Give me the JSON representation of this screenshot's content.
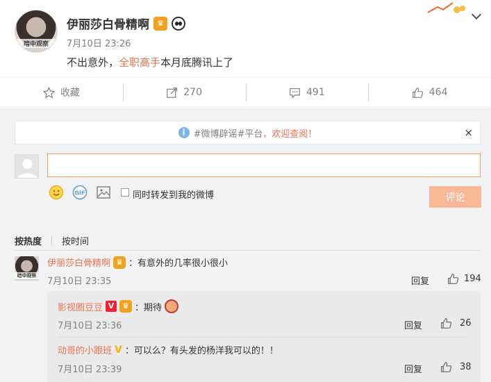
{
  "post": {
    "user_name": "伊丽莎白骨精啊",
    "avatar_caption": "暗中观察",
    "time": "7月10日 23:26",
    "text_before": "不出意外，",
    "text_highlight": "全职高手",
    "text_after": "本月底腾讯上了"
  },
  "actions": {
    "favorite_label": "收藏",
    "repost_count": "270",
    "comment_count": "491",
    "like_count": "464"
  },
  "notice": {
    "text_link": "#微博辟谣#平台",
    "text_rest": "，欢迎查阅！",
    "close": "×"
  },
  "composer": {
    "input_value": "",
    "forward_label": "同时转发到我的微博",
    "submit_label": "评论"
  },
  "sort_tabs": [
    "按热度",
    "按时间"
  ],
  "comments": [
    {
      "user": "伊丽莎白骨精啊",
      "avatar_caption": "暗中观察",
      "text": "：有意外的几率很小很小",
      "time": "7月10日 23:35",
      "reply": "回复",
      "likes": "194"
    }
  ],
  "sub_comments": [
    {
      "user": "影视圈豆豆",
      "badge": "V",
      "text": "：期待",
      "time": "7月10日 23:36",
      "reply": "回复",
      "likes": "26"
    },
    {
      "user": "动哥的小跟班",
      "badge": "V",
      "text": "：可以么？有头发的杨洋我可以的！！",
      "time": "7月10日 23:39",
      "reply": "回复",
      "likes": "38"
    }
  ],
  "colors": {
    "accent": "#eb7350",
    "submit_disabled": "#f9b999",
    "panel_bg": "#f2f2f5"
  }
}
